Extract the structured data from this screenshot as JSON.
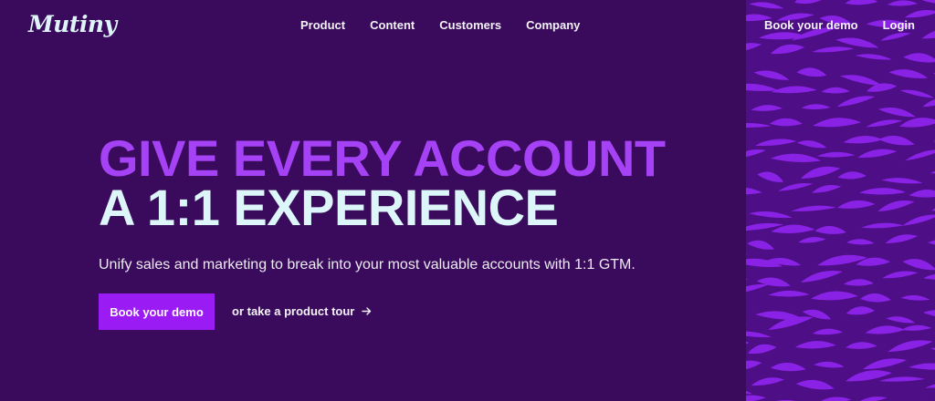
{
  "header": {
    "logo": "Mutiny",
    "nav": [
      "Product",
      "Content",
      "Customers",
      "Company"
    ],
    "book_demo": "Book your demo",
    "login": "Login"
  },
  "hero": {
    "headline_line1": "GIVE EVERY ACCOUNT",
    "headline_line2": "A 1:1 EXPERIENCE",
    "subtitle": "Unify sales and marketing to break into your most valuable accounts with 1:1 GTM.",
    "cta_label": "Book your demo",
    "tour_label": "or take a product tour"
  },
  "colors": {
    "background": "#3a0a5c",
    "accent_purple": "#a542f5",
    "headline_light": "#dcf6fa",
    "cta": "#9b1bf4",
    "pattern_bg": "#4d0e86",
    "pattern_stroke": "#8a22e6"
  },
  "icons": {
    "tour_arrow": "arrow-right-icon"
  }
}
